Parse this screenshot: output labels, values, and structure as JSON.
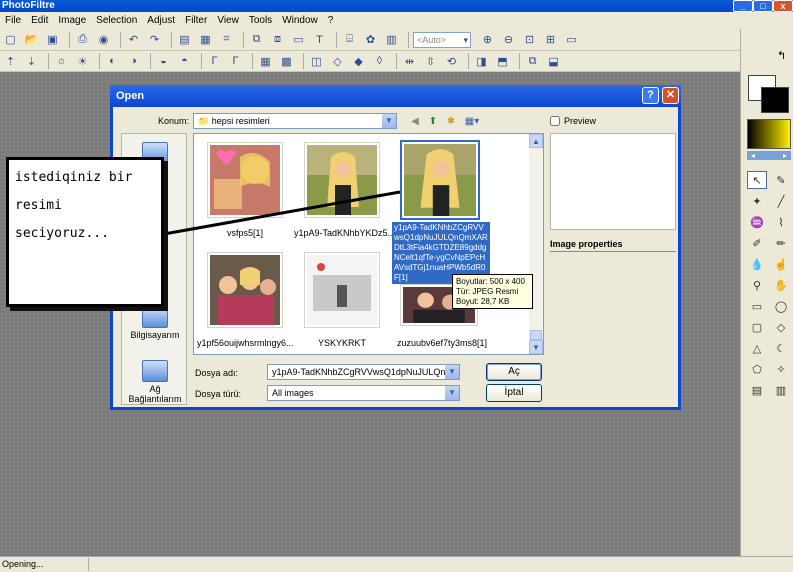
{
  "app": {
    "title": "PhotoFiltre"
  },
  "menu": [
    "File",
    "Edit",
    "Image",
    "Selection",
    "Adjust",
    "Filter",
    "View",
    "Tools",
    "Window",
    "?"
  ],
  "toolbar": {
    "zoom_value": "<Auto>"
  },
  "status": {
    "text": "Opening..."
  },
  "dialog": {
    "title": "Open",
    "help_label": "?",
    "close_label": "✕",
    "location_label": "Konum:",
    "location_value": "hepsi resimleri",
    "preview_label": "Preview",
    "image_properties_label": "Image properties",
    "filename_label": "Dosya adı:",
    "filename_value": "y1pA9-TadKNhbZCgRVVwsQ1dpNuJULQnQm",
    "filetype_label": "Dosya türü:",
    "filetype_value": "All images",
    "open_button": "Aç",
    "cancel_button": "İptal",
    "places": [
      "Bilgisayarım",
      "Ağ Bağlantılarım"
    ],
    "files": [
      {
        "name": "vsfps5[1]"
      },
      {
        "name": "y1pA9-TadKNhbYKDz5..."
      },
      {
        "name": "y1pA9-TadKNhbZCgRVVwsQ1dpNuJULQnQmXARDtL3tFia4kGTDZE89gddgNCelt1qfTe-ygCvNpEPcHAVsdTGj1nuaHPWb5dR0F[1]"
      },
      {
        "name": "y1pf56ouijwhsrmlngy6..."
      },
      {
        "name": "YSKYKRKT"
      },
      {
        "name": "zuzuubv6ef7ty3ms8[1]"
      }
    ],
    "tooltip": {
      "size": "Boyutlar: 500 x 400",
      "type": "Tür: JPEG Resmi",
      "filesize": "Boyut: 28,7 KB"
    }
  },
  "annotation": {
    "line1": "istediqiniz bir",
    "line2": "resimi",
    "line3": "seciyoruz..."
  },
  "colors": {
    "titlebar": "#0a46d0",
    "selection": "#316ac5",
    "workspace": "#7b7b7b"
  }
}
